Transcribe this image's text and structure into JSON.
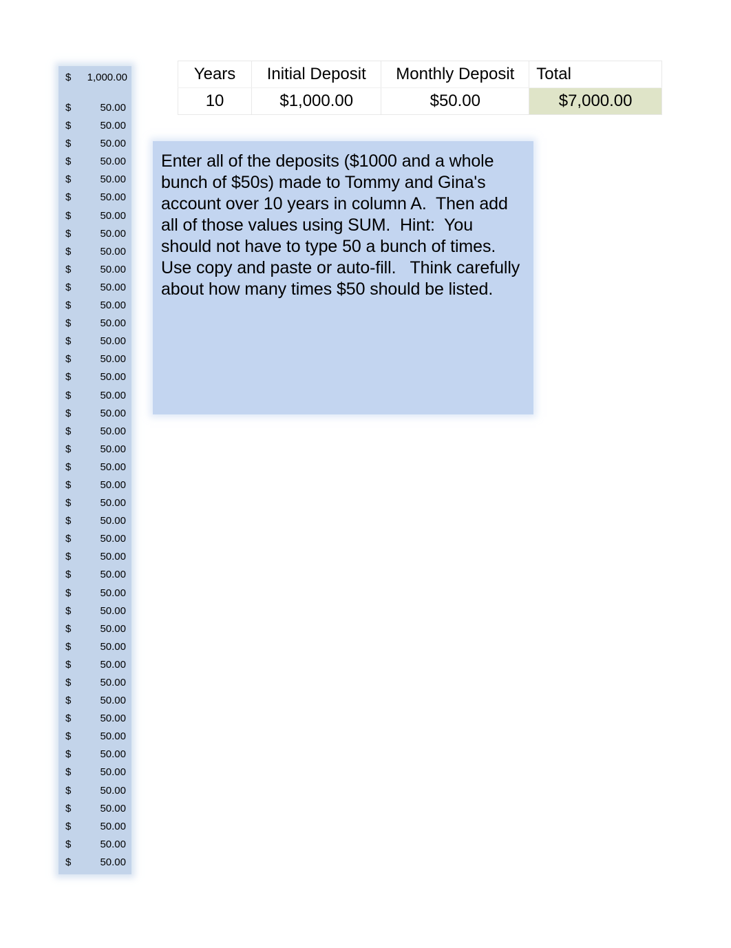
{
  "document": {
    "type": "spreadsheet-worksheet",
    "colors": {
      "column_fill": "#c3d4ea",
      "instruction_fill": "#c3d5f0",
      "total_highlight": "#dfe4c8",
      "page_background": "#ffffff",
      "text": "#000000"
    }
  },
  "summary": {
    "headers": {
      "years": "Years",
      "initial_deposit": "Initial Deposit",
      "monthly_deposit": "Monthly Deposit",
      "total": "Total"
    },
    "values": {
      "years": "10",
      "initial_deposit": "$1,000.00",
      "monthly_deposit": "$50.00",
      "total": "$7,000.00"
    }
  },
  "instruction": {
    "text": "Enter all of the deposits ($1000 and a whole bunch of $50s) made to Tommy and Gina's account over 10 years in column A.  Then add all of those values using SUM.  Hint:  You should not have to type 50 a bunch of times.  Use copy and paste or auto-fill.   Think carefully about how many times $50 should be listed."
  },
  "deposit_column": {
    "currency_symbol": "$",
    "initial_deposit_amount": "1,000.00",
    "monthly_deposit_amount": "50.00",
    "monthly_row_count": 43
  }
}
